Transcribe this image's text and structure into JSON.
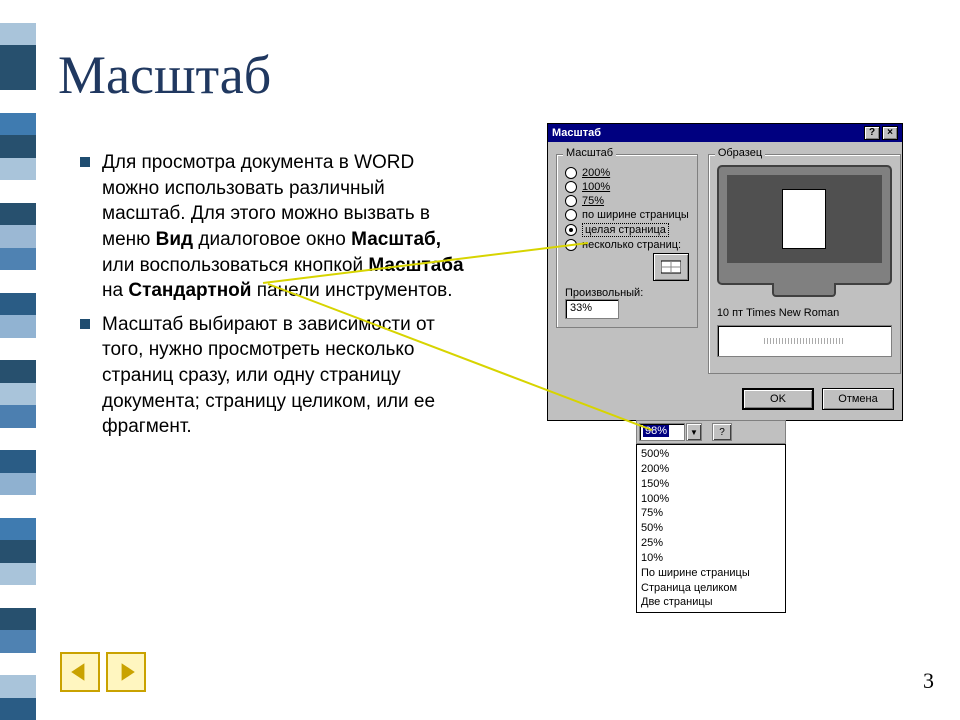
{
  "title": "Масштаб",
  "bullets": [
    {
      "html": "Для просмотра документа в WORD можно использовать различный масштаб. Для этого можно вызвать в меню <b>Вид</b> диалоговое окно <b>Масштаб,</b> или воспользоваться кнопкой <b>Масштаба</b> на <b>Стандартной</b> панели инструментов."
    },
    {
      "html": "Масштаб выбирают в зависимости от того, нужно просмотреть несколько страниц сразу, или одну страницу документа; страницу целиком, или ее фрагмент."
    }
  ],
  "dialog": {
    "title": "Масштаб",
    "group_zoom_label": "Масштаб",
    "group_preview_label": "Образец",
    "radios": {
      "r200": "200%",
      "r100": "100%",
      "r75": "75%",
      "page_width": "по ширине страницы",
      "whole_page": "целая страница",
      "multi_pages": "несколько страниц:"
    },
    "custom_label": "Произвольный:",
    "custom_value": "33%",
    "preview_font": "10 пт Times New Roman",
    "ok": "OK",
    "cancel": "Отмена"
  },
  "toolbar": {
    "zoom_value": "98%"
  },
  "dropdown": [
    "500%",
    "200%",
    "150%",
    "100%",
    "75%",
    "50%",
    "25%",
    "10%",
    "По ширине страницы",
    "Страница целиком",
    "Две страницы"
  ],
  "page_number": "3",
  "stripe_colors": [
    "#ffffff",
    "#a9c4da",
    "#27506e",
    "#27506e",
    "#ffffff",
    "#3f7bb0",
    "#27506e",
    "#a9c4da",
    "#ffffff",
    "#27506e",
    "#9bb8d4",
    "#4f82b2",
    "#ffffff",
    "#2a5c85",
    "#91b3d2",
    "#ffffff",
    "#27506e",
    "#a9c4da",
    "#4c7fb0",
    "#ffffff",
    "#2a5c85",
    "#8fb1d0",
    "#ffffff",
    "#3f7bb0",
    "#27506e",
    "#a9c4da",
    "#ffffff",
    "#27506e",
    "#4f82b2",
    "#ffffff",
    "#a9c4da",
    "#2a5c85"
  ]
}
